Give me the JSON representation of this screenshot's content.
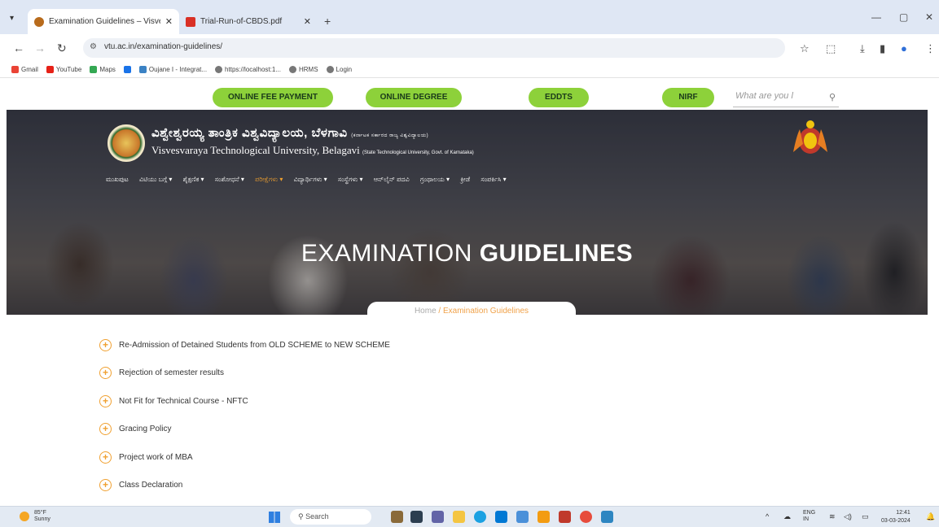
{
  "browser": {
    "tabs": [
      {
        "title": "Examination Guidelines – Visve...",
        "active": true
      },
      {
        "title": "Trial-Run-of-CBDS.pdf",
        "active": false
      }
    ],
    "url": "vtu.ac.in/examination-guidelines/",
    "bookmarks": [
      "Gmail",
      "YouTube",
      "Maps",
      "",
      "Oujane I - Integrat...",
      "https://localhost:1...",
      "HRMS",
      "Login"
    ]
  },
  "topnav": {
    "buttons": [
      "ONLINE FEE PAYMENT",
      "ONLINE DEGREE",
      "EDDTS",
      "NIRF"
    ],
    "search_placeholder": "What are you l"
  },
  "header": {
    "uni_name_kn": "ವಿಶ್ವೇಶ್ವರಯ್ಯ ತಾಂತ್ರಿಕ ವಿಶ್ವವಿದ್ಯಾಲಯ, ಬೆಳಗಾವಿ",
    "uni_sub_kn": "(ಕರ್ನಾಟಕ ಸರ್ಕಾರದ ರಾಜ್ಯ ವಿಶ್ವವಿದ್ಯಾಲಯ)",
    "uni_name_en": "Visvesvaraya Technological University, Belagavi",
    "uni_sub_en": "(State Technological University, Govt. of Karnataka)",
    "menu": [
      "ಮುಖಪುಟ",
      "ವಿಟಿಯು ಬಗ್ಗೆ ▾",
      "ಶೈಕ್ಷಣಿಕ ▾",
      "ಸಂಶೋಧನೆ ▾",
      "ಪರೀಕ್ಷೆಗಳು ▾",
      "ವಿದ್ಯಾರ್ಥಿಗಳು ▾",
      "ಸಂಸ್ಥೆಗಳು ▾",
      "ಆನ್‌ಲೈನ್ ಪದವಿ",
      "ಗ್ರಂಥಾಲಯ ▾",
      "ಕ್ರೀಡೆ",
      "ಸಂಪರ್ಕಿಸಿ ▾"
    ],
    "menu_highlight_index": 4
  },
  "hero": {
    "title_light": "EXAMINATION",
    "title_bold": "GUIDELINES",
    "breadcrumb_home": "Home",
    "breadcrumb_sep": " / ",
    "breadcrumb_current": "Examination Guidelines"
  },
  "guidelines": [
    "Re-Admission of Detained Students from OLD SCHEME to NEW SCHEME",
    "Rejection of semester results",
    "Not Fit for Technical Course - NFTC",
    "Gracing Policy",
    "Project work of MBA",
    "Class Declaration"
  ],
  "taskbar": {
    "weather_temp": "85°F",
    "weather_desc": "Sunny",
    "search": "Search",
    "lang": "ENG",
    "lang_sub": "IN",
    "time": "12:41",
    "date": "03-03-2024"
  },
  "colors": {
    "green_button": "#8dd13a",
    "accent_orange": "#f0a030"
  }
}
